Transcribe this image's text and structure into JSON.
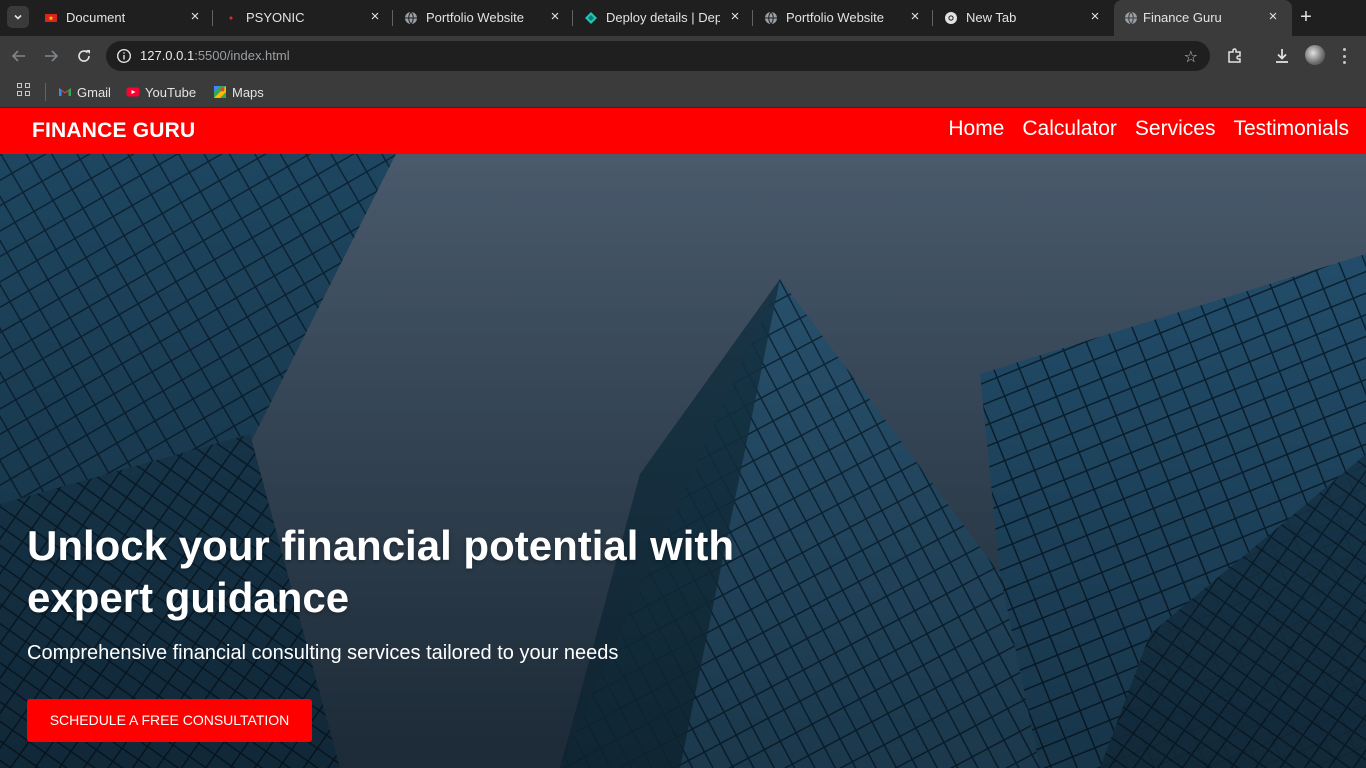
{
  "browser": {
    "tabs": [
      {
        "title": "Document",
        "favicon": "flag-favicon",
        "active": false
      },
      {
        "title": "PSYONIC",
        "favicon": "red-dot-favicon",
        "active": false
      },
      {
        "title": "Portfolio Website",
        "favicon": "globe-favicon",
        "active": false
      },
      {
        "title": "Deploy details | Dep",
        "favicon": "netlify-favicon",
        "active": false
      },
      {
        "title": "Portfolio Website",
        "favicon": "globe-favicon",
        "active": false
      },
      {
        "title": "New Tab",
        "favicon": "chrome-favicon",
        "active": false
      },
      {
        "title": "Finance Guru",
        "favicon": "globe-favicon",
        "active": true
      }
    ],
    "address": {
      "host": "127.0.0.1",
      "rest": ":5500/index.html"
    },
    "bookmarks": [
      {
        "label": "Gmail",
        "icon": "gmail-icon"
      },
      {
        "label": "YouTube",
        "icon": "youtube-icon"
      },
      {
        "label": "Maps",
        "icon": "maps-icon"
      }
    ],
    "colors": {
      "tabstrip": "#1f1f1f",
      "toolbar": "#3b3b3b",
      "omnibox": "#1f1f1f"
    }
  },
  "site": {
    "brand": "FINANCE GURU",
    "nav": [
      "Home",
      "Calculator",
      "Services",
      "Testimonials"
    ],
    "hero": {
      "title": "Unlock your financial potential with expert guidance",
      "subtitle": "Comprehensive financial consulting services tailored to your needs",
      "cta": "SCHEDULE A FREE CONSULTATION"
    },
    "colors": {
      "accent": "#ff0000",
      "text": "#ffffff"
    }
  }
}
